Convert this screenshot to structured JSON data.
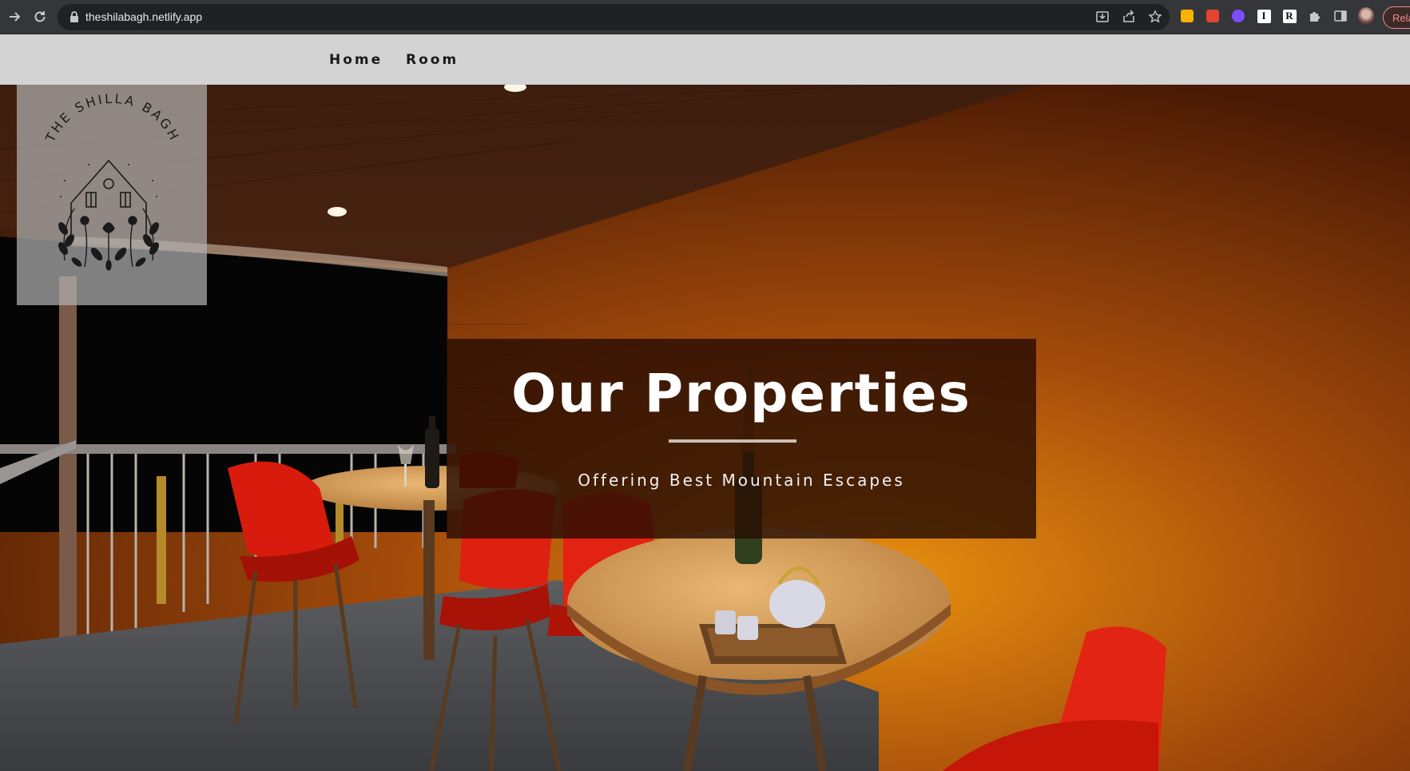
{
  "browser": {
    "url": "theshilabagh.netlify.app",
    "relaunch_label": "Rela",
    "extensions": [
      {
        "icon": "keep-extension-icon",
        "color": "#f6b300"
      },
      {
        "icon": "todoist-extension-icon",
        "color": "#e44332"
      },
      {
        "icon": "purple-extension-icon",
        "color": "#7c4dff"
      },
      {
        "icon": "instapaper-extension-icon",
        "letter": "I"
      },
      {
        "icon": "readwise-extension-icon",
        "letter": "R"
      }
    ]
  },
  "nav": {
    "items": [
      {
        "label": "Home"
      },
      {
        "label": "Room"
      }
    ]
  },
  "logo": {
    "text": "THE SHILLA BAGH"
  },
  "hero": {
    "title": "Our Properties",
    "subtitle": "Offering Best Mountain Escapes"
  },
  "colors": {
    "header_bg": "#d3d3d3",
    "title_box_bg": "#280e02",
    "chair_red": "#d81b0c",
    "wall_orange": "#a04a0a"
  }
}
